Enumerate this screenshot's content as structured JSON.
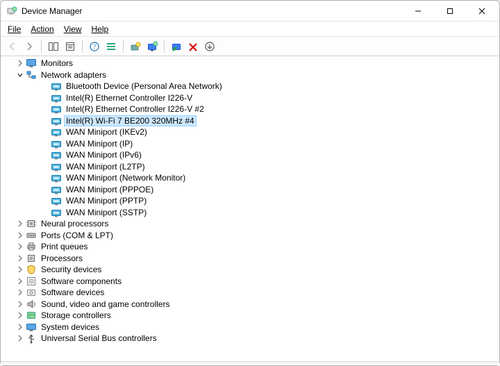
{
  "window": {
    "title": "Device Manager"
  },
  "menu": {
    "file": "File",
    "action": "Action",
    "view": "View",
    "help": "Help"
  },
  "toolbar": {
    "back": "Back",
    "forward": "Forward",
    "show_hide_tree": "Show/Hide Console Tree",
    "properties": "Properties",
    "help": "Help",
    "view_menu": "View menu",
    "update_driver": "Update driver",
    "scan": "Scan for hardware changes",
    "enable": "Enable device",
    "disable": "Disable device",
    "uninstall": "Uninstall device",
    "add_legacy": "Add legacy hardware"
  },
  "tree": {
    "categories": [
      {
        "label": "Monitors",
        "icon": "monitor",
        "expanded": false,
        "children": []
      },
      {
        "label": "Network adapters",
        "icon": "network",
        "expanded": true,
        "children": [
          {
            "label": "Bluetooth Device (Personal Area Network)",
            "icon": "netadapter"
          },
          {
            "label": "Intel(R) Ethernet Controller I226-V",
            "icon": "netadapter"
          },
          {
            "label": "Intel(R) Ethernet Controller I226-V #2",
            "icon": "netadapter"
          },
          {
            "label": "Intel(R) Wi-Fi 7 BE200 320MHz #4",
            "icon": "netadapter",
            "selected": true
          },
          {
            "label": "WAN Miniport (IKEv2)",
            "icon": "netadapter"
          },
          {
            "label": "WAN Miniport (IP)",
            "icon": "netadapter"
          },
          {
            "label": "WAN Miniport (IPv6)",
            "icon": "netadapter"
          },
          {
            "label": "WAN Miniport (L2TP)",
            "icon": "netadapter"
          },
          {
            "label": "WAN Miniport (Network Monitor)",
            "icon": "netadapter"
          },
          {
            "label": "WAN Miniport (PPPOE)",
            "icon": "netadapter"
          },
          {
            "label": "WAN Miniport (PPTP)",
            "icon": "netadapter"
          },
          {
            "label": "WAN Miniport (SSTP)",
            "icon": "netadapter"
          }
        ]
      },
      {
        "label": "Neural processors",
        "icon": "chip",
        "expanded": false,
        "children": []
      },
      {
        "label": "Ports (COM & LPT)",
        "icon": "port",
        "expanded": false,
        "children": []
      },
      {
        "label": "Print queues",
        "icon": "printer",
        "expanded": false,
        "children": []
      },
      {
        "label": "Processors",
        "icon": "cpu",
        "expanded": false,
        "children": []
      },
      {
        "label": "Security devices",
        "icon": "security",
        "expanded": false,
        "children": []
      },
      {
        "label": "Software components",
        "icon": "swcomp",
        "expanded": false,
        "children": []
      },
      {
        "label": "Software devices",
        "icon": "swdev",
        "expanded": false,
        "children": []
      },
      {
        "label": "Sound, video and game controllers",
        "icon": "sound",
        "expanded": false,
        "children": []
      },
      {
        "label": "Storage controllers",
        "icon": "storage",
        "expanded": false,
        "children": []
      },
      {
        "label": "System devices",
        "icon": "system",
        "expanded": false,
        "children": []
      },
      {
        "label": "Universal Serial Bus controllers",
        "icon": "usb",
        "expanded": false,
        "children": []
      }
    ]
  }
}
